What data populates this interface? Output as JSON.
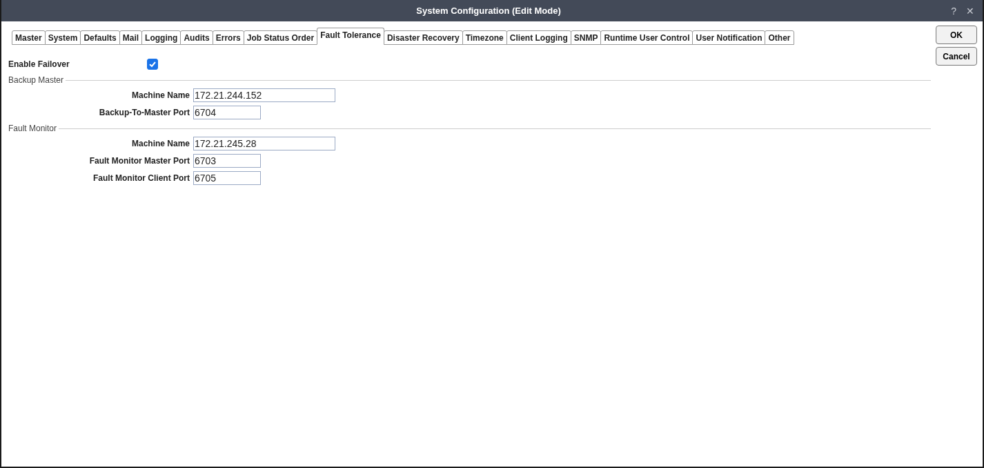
{
  "window": {
    "title": "System Configuration (Edit Mode)",
    "help": "?",
    "close": "✕"
  },
  "tabs": [
    {
      "label": "Master",
      "selected": false
    },
    {
      "label": "System",
      "selected": false
    },
    {
      "label": "Defaults",
      "selected": false
    },
    {
      "label": "Mail",
      "selected": false
    },
    {
      "label": "Logging",
      "selected": false
    },
    {
      "label": "Audits",
      "selected": false
    },
    {
      "label": "Errors",
      "selected": false
    },
    {
      "label": "Job Status Order",
      "selected": false
    },
    {
      "label": "Fault Tolerance",
      "selected": true
    },
    {
      "label": "Disaster Recovery",
      "selected": false
    },
    {
      "label": "Timezone",
      "selected": false
    },
    {
      "label": "Client Logging",
      "selected": false
    },
    {
      "label": "SNMP",
      "selected": false
    },
    {
      "label": "Runtime User Control",
      "selected": false
    },
    {
      "label": "User Notification",
      "selected": false
    },
    {
      "label": "Other",
      "selected": false
    }
  ],
  "enable_failover": {
    "label": "Enable Failover",
    "checked": true
  },
  "sections": [
    {
      "title": "Backup Master",
      "fields": [
        {
          "label": "Machine Name",
          "value": "172.21.244.152",
          "kind": "address"
        },
        {
          "label": "Backup-To-Master Port",
          "value": "6704",
          "kind": "port"
        }
      ]
    },
    {
      "title": "Fault Monitor",
      "fields": [
        {
          "label": "Machine Name",
          "value": "172.21.245.28",
          "kind": "address"
        },
        {
          "label": "Fault Monitor Master Port",
          "value": "6703",
          "kind": "port"
        },
        {
          "label": "Fault Monitor Client Port",
          "value": "6705",
          "kind": "port"
        }
      ]
    }
  ],
  "buttons": [
    "OK",
    "Cancel"
  ]
}
